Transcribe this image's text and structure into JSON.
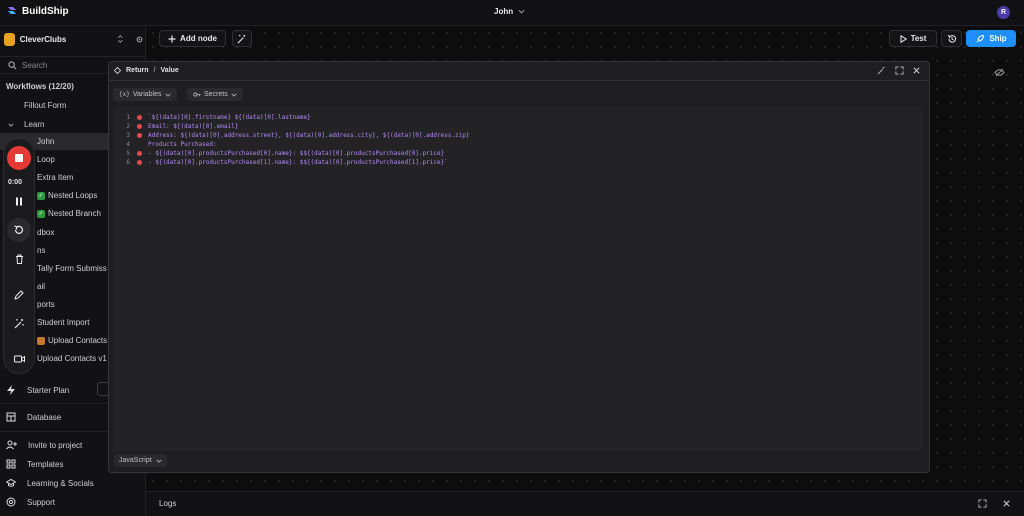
{
  "app": {
    "name": "BuildShip",
    "user_initial": "R"
  },
  "workflow_title": "John",
  "project": {
    "name": "CleverClubs"
  },
  "search": {
    "placeholder": "Search"
  },
  "sidebar": {
    "workflows_header": "Workflows (12/20)",
    "items": [
      {
        "label": "Fillout Form"
      },
      {
        "label": "Learn"
      },
      {
        "label": "John"
      },
      {
        "label": "Loop"
      },
      {
        "label": "Extra Item"
      },
      {
        "label": "Nested Loops"
      },
      {
        "label": "Nested Branch"
      },
      {
        "label": "dbox"
      },
      {
        "label": "ns"
      },
      {
        "label": "Tally Form Submiss"
      },
      {
        "label": "ail"
      },
      {
        "label": "ports"
      },
      {
        "label": "Student Import"
      },
      {
        "label": "Upload Contacts"
      },
      {
        "label": "Upload Contacts v1"
      }
    ],
    "starter_plan": "Starter Plan",
    "database": "Database",
    "invite": "Invite to project",
    "templates": "Templates",
    "learning": "Learning & Socials",
    "support": "Support"
  },
  "recorder": {
    "time": "0:00"
  },
  "toolbar": {
    "add_node": "Add node",
    "test": "Test",
    "ship": "Ship"
  },
  "modal": {
    "breadcrumb_1": "Return",
    "breadcrumb_sep": "/",
    "breadcrumb_2": "Value",
    "variables": "Variables",
    "secrets": "Secrets",
    "code_lines": [
      {
        "n": "1",
        "marker": true,
        "text": "`${(data)[0].firstname} ${(data)[0].lastname}"
      },
      {
        "n": "2",
        "marker": true,
        "text": "Email: ${(data)[0].email}"
      },
      {
        "n": "3",
        "marker": true,
        "text": "Address: ${(data)[0].address.street}, ${(data)[0].address.city}, ${(data)[0].address.zip}"
      },
      {
        "n": "4",
        "marker": false,
        "text": "Products Purchased:"
      },
      {
        "n": "5",
        "marker": true,
        "text": "- ${(data)[0].productsPurchased[0].name}: $${(data)[0].productsPurchased[0].price}"
      },
      {
        "n": "6",
        "marker": true,
        "text": "- ${(data)[0].productsPurchased[1].name}: $${(data)[0].productsPurchased[1].price}`"
      }
    ],
    "language": "JavaScript"
  },
  "bottom": {
    "logs": "Logs"
  },
  "colors": {
    "accent": "#1f8fff",
    "record": "#e53935",
    "code": "#b08af2"
  }
}
